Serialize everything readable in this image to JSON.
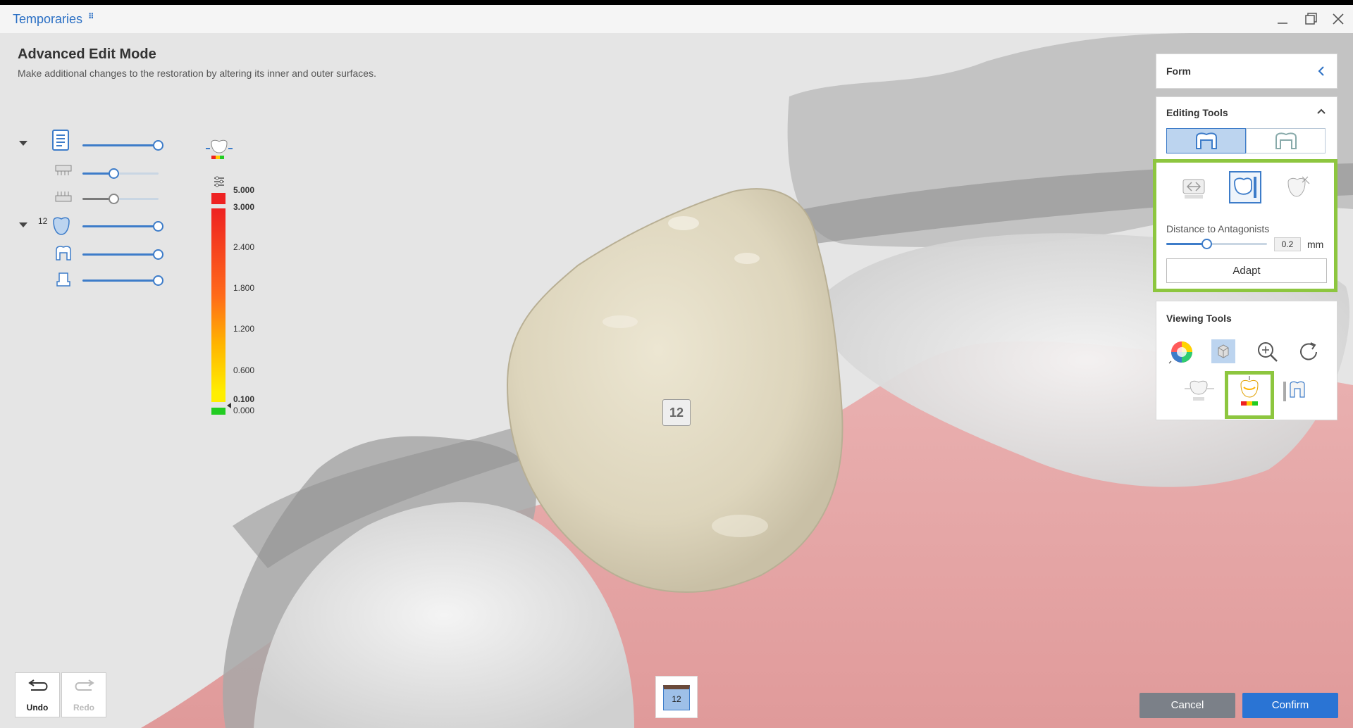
{
  "app": {
    "title": "Temporaries",
    "title_badge": "⠿"
  },
  "header": {
    "title": "Advanced Edit Mode",
    "description": "Make additional changes to the restoration by altering its inner and outer surfaces."
  },
  "layers": {
    "group_number": "12",
    "items": [
      {
        "icon": "model-document-icon",
        "level": 1.0
      },
      {
        "icon": "upper-jaw-icon",
        "level": 0.4
      },
      {
        "icon": "lower-jaw-icon",
        "level": 0.4
      },
      {
        "icon": "crown-icon",
        "level": 1.0
      },
      {
        "icon": "inner-crown-icon",
        "level": 1.0
      },
      {
        "icon": "abutment-icon",
        "level": 1.0
      }
    ]
  },
  "color_scale": {
    "labels": [
      "5.000",
      "3.000",
      "2.400",
      "1.800",
      "1.200",
      "0.600",
      "0.100",
      "0.000"
    ],
    "colors": {
      "high": "#ee2222",
      "mid": "#ff8c1a",
      "low": "#ffee00",
      "min": "#22cc22"
    }
  },
  "form_panel": {
    "title": "Form"
  },
  "editing_tools": {
    "title": "Editing Tools",
    "distance_label": "Distance to Antagonists",
    "distance_value": "0.2",
    "distance_unit": "mm",
    "distance_level": 0.4,
    "adapt_label": "Adapt"
  },
  "viewing_tools": {
    "title": "Viewing Tools"
  },
  "tooth_label": "12",
  "tooth_tab": "12",
  "history": {
    "undo_label": "Undo",
    "redo_label": "Redo"
  },
  "actions": {
    "cancel_label": "Cancel",
    "confirm_label": "Confirm"
  },
  "colors": {
    "accent": "#2a74d4",
    "highlight": "#8dc63f",
    "gum": "#e8a0a0",
    "tooth": "#e7e1cc"
  }
}
